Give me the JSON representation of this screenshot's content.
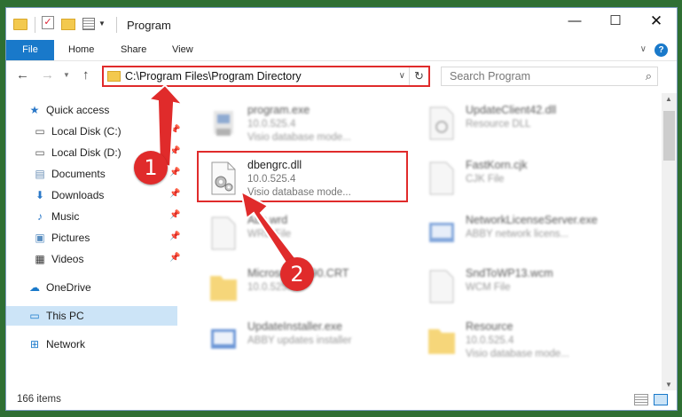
{
  "window": {
    "title": "Program"
  },
  "ribbon": {
    "tabs": [
      "File",
      "Home",
      "Share",
      "View"
    ]
  },
  "nav": {
    "address": "C:\\Program Files\\Program Directory",
    "search_placeholder": "Search Program"
  },
  "sidebar": {
    "items": [
      {
        "label": "Quick access",
        "icon": "star-icon",
        "pinned": false
      },
      {
        "label": "Local Disk (C:)",
        "icon": "drive-icon",
        "pinned": true
      },
      {
        "label": "Local Disk (D:)",
        "icon": "drive-icon",
        "pinned": true
      },
      {
        "label": "Documents",
        "icon": "documents-icon",
        "pinned": true
      },
      {
        "label": "Downloads",
        "icon": "download-icon",
        "pinned": true
      },
      {
        "label": "Music",
        "icon": "music-icon",
        "pinned": true
      },
      {
        "label": "Pictures",
        "icon": "pictures-icon",
        "pinned": true
      },
      {
        "label": "Videos",
        "icon": "videos-icon",
        "pinned": true
      },
      {
        "label": "OneDrive",
        "icon": "cloud-icon",
        "pinned": false
      },
      {
        "label": "This PC",
        "icon": "pc-icon",
        "pinned": false,
        "selected": true
      },
      {
        "label": "Network",
        "icon": "network-icon",
        "pinned": false
      }
    ]
  },
  "files": [
    {
      "name": "program.exe",
      "line2": "10.0.525.4",
      "line3": "Visio database mode...",
      "icon": "exe-icon"
    },
    {
      "name": "UpdateClient42.dll",
      "line2": "Resource DLL",
      "line3": "",
      "icon": "dll-icon"
    },
    {
      "name": "dbengrc.dll",
      "line2": "10.0.525.4",
      "line3": "Visio database mode...",
      "icon": "dll-gear-icon",
      "highlighted": true
    },
    {
      "name": "FastKorn.cjk",
      "line2": "CJK File",
      "line3": "",
      "icon": "file-icon"
    },
    {
      "name": "Abc.wrd",
      "line2": "WRD File",
      "line3": "",
      "icon": "file-icon"
    },
    {
      "name": "NetworkLicenseServer.exe",
      "line2": "ABBY network licens...",
      "line3": "",
      "icon": "exe-icon"
    },
    {
      "name": "Microsoft.VC90.CRT",
      "line2": "10.0.525.4",
      "line3": "",
      "icon": "folder-icon"
    },
    {
      "name": "SndToWP13.wcm",
      "line2": "WCM File",
      "line3": "",
      "icon": "file-icon"
    },
    {
      "name": "UpdateInstaller.exe",
      "line2": "ABBY updates installer",
      "line3": "",
      "icon": "exe-icon"
    },
    {
      "name": "Resource",
      "line2": "10.0.525.4",
      "line3": "Visio database mode...",
      "icon": "folder-icon"
    }
  ],
  "status": {
    "items_count": "166 items"
  },
  "callouts": [
    "1",
    "2"
  ],
  "colors": {
    "accent": "#1979ca",
    "highlight": "#e02b2b",
    "selected": "#cce4f7"
  }
}
